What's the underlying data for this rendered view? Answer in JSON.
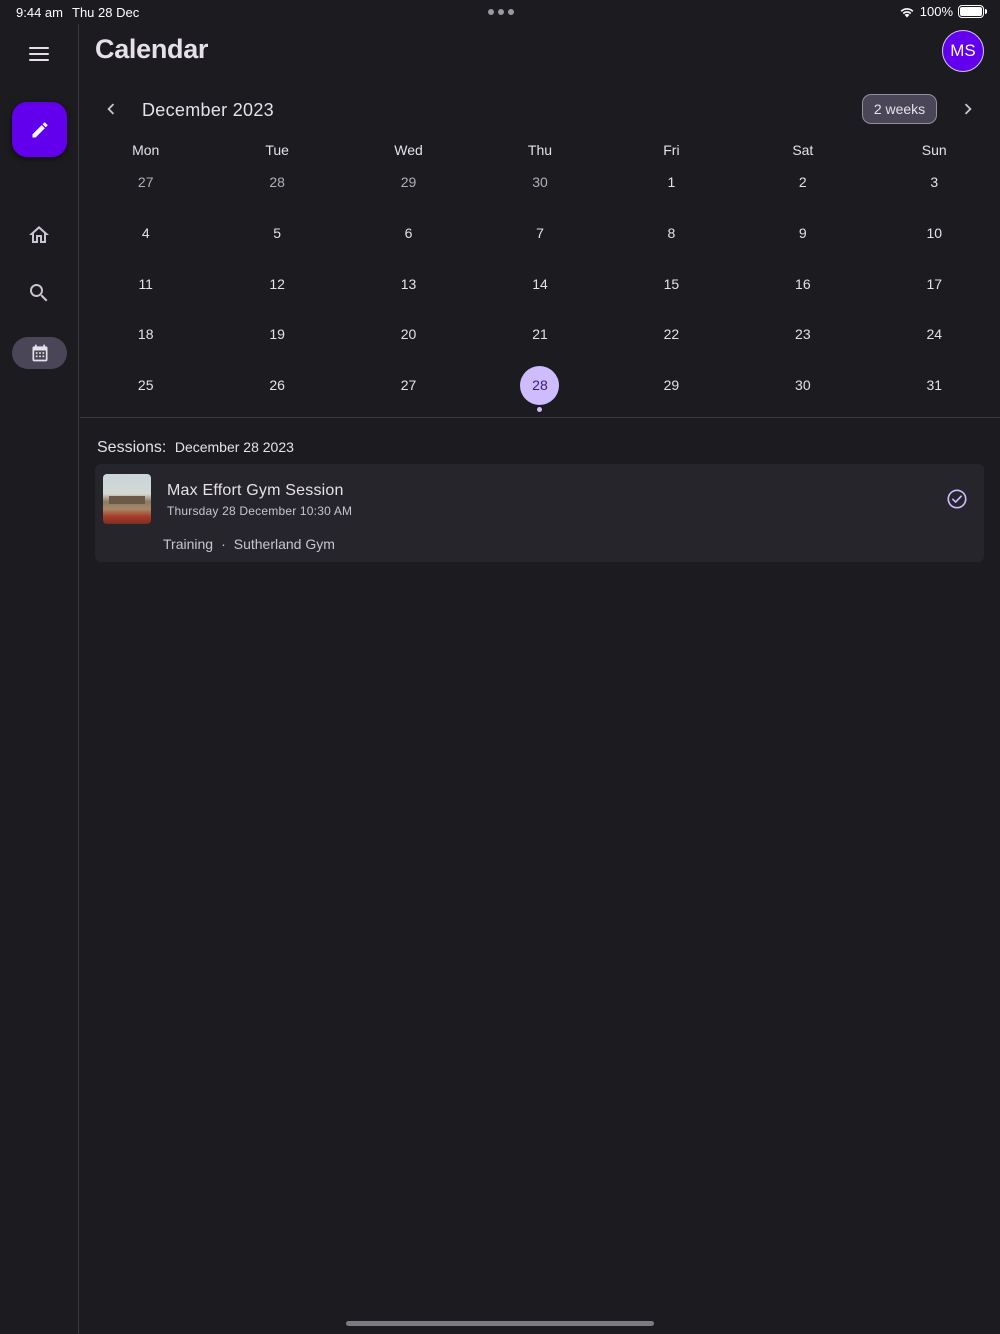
{
  "status_bar": {
    "time": "9:44 am",
    "date": "Thu 28 Dec",
    "battery": "100%"
  },
  "rail": {
    "menu_icon": "menu-icon",
    "fab_icon": "pencil-icon",
    "items": [
      {
        "icon": "home-icon",
        "active": false
      },
      {
        "icon": "search-icon",
        "active": false
      },
      {
        "icon": "calendar-icon",
        "active": true
      }
    ]
  },
  "header": {
    "title": "Calendar",
    "avatar_initials": "MS"
  },
  "calendar": {
    "month_label": "December 2023",
    "format_button": "2 weeks",
    "weekdays": [
      "Mon",
      "Tue",
      "Wed",
      "Thu",
      "Fri",
      "Sat",
      "Sun"
    ],
    "weeks": [
      [
        "27",
        "28",
        "29",
        "30",
        "1",
        "2",
        "3"
      ],
      [
        "4",
        "5",
        "6",
        "7",
        "8",
        "9",
        "10"
      ],
      [
        "11",
        "12",
        "13",
        "14",
        "15",
        "16",
        "17"
      ],
      [
        "18",
        "19",
        "20",
        "21",
        "22",
        "23",
        "24"
      ],
      [
        "25",
        "26",
        "27",
        "28",
        "29",
        "30",
        "31"
      ]
    ],
    "selected_day": "28"
  },
  "sessions": {
    "label": "Sessions:",
    "date": "December 28 2023",
    "items": [
      {
        "title": "Max Effort Gym Session",
        "datetime": "Thursday 28 December 10:30 AM",
        "category": "Training",
        "separator": "·",
        "location": "Sutherland Gym",
        "completed": true
      }
    ]
  },
  "colors": {
    "background": "#1c1b20",
    "accent": "#6200ee",
    "selected_day": "#cfbcff",
    "card": "#27252c"
  }
}
